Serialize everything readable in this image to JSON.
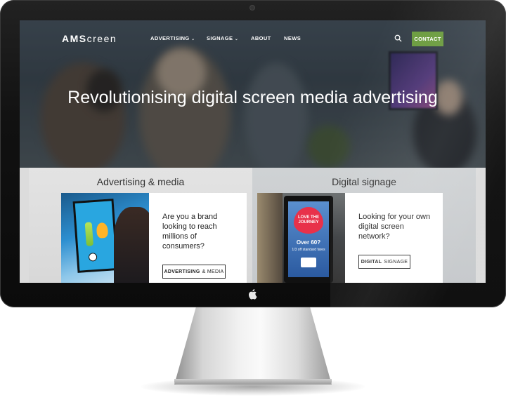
{
  "site": {
    "logo": {
      "bold": "AMS",
      "rest": "creen"
    },
    "nav": [
      {
        "label": "ADVERTISING",
        "has_dropdown": true
      },
      {
        "label": "SIGNAGE",
        "has_dropdown": true
      },
      {
        "label": "ABOUT",
        "has_dropdown": false
      },
      {
        "label": "NEWS",
        "has_dropdown": false
      }
    ],
    "search_icon": "search-icon",
    "contact_label": "CONTACT",
    "hero_title": "Revolutionising digital screen media advertising",
    "panels": [
      {
        "title": "Advertising & media",
        "text": "Are you a brand looking to reach millions of consumers?",
        "button_bold": "ADVERTISING",
        "button_rest": "& MEDIA"
      },
      {
        "title": "Digital signage",
        "text": "Looking for your own digital screen network?",
        "button_bold": "DIGITAL",
        "button_rest": "SIGNAGE"
      }
    ],
    "kiosk": {
      "heart_text": "LOVE THE JOURNEY",
      "headline": "Over 60?",
      "subline": "1/3 off standard fares"
    }
  },
  "colors": {
    "accent": "#6a9b3d",
    "bezel": "#111111"
  }
}
